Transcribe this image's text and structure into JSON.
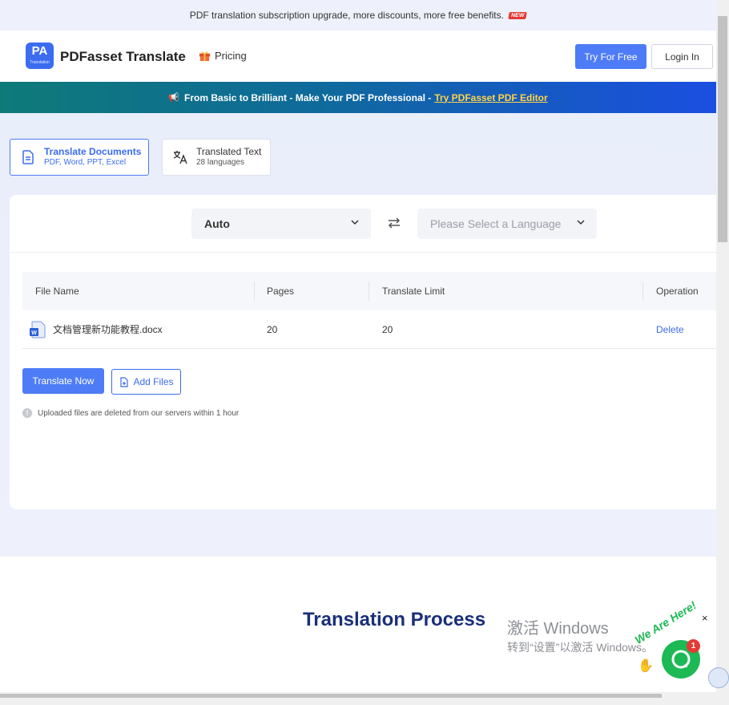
{
  "topbar": {
    "text": "PDF translation subscription upgrade, more discounts, more free benefits.",
    "badge": "NEW"
  },
  "header": {
    "logo_text": "PA",
    "logo_sub": "Translation",
    "brand": "PDFasset Translate",
    "pricing": "Pricing",
    "try_label": "Try For Free",
    "login_label": "Login In"
  },
  "promo": {
    "text": "From Basic to Brilliant - Make Your PDF Professional -",
    "link": "Try PDFasset PDF Editor"
  },
  "tabs": [
    {
      "title": "Translate Documents",
      "subtitle": "PDF, Word, PPT, Excel"
    },
    {
      "title": "Translated Text",
      "subtitle": "28 languages"
    }
  ],
  "language": {
    "source": "Auto",
    "target_placeholder": "Please Select a Language"
  },
  "table": {
    "headers": [
      "File Name",
      "Pages",
      "Translate Limit",
      "Operation"
    ],
    "rows": [
      {
        "file": "文档管理新功能教程.docx",
        "pages": "20",
        "limit": "20",
        "action": "Delete"
      }
    ]
  },
  "actions": {
    "translate": "Translate Now",
    "add": "Add Files"
  },
  "note": "Uploaded files are deleted from our servers within 1 hour",
  "section": {
    "title": "Translation Process"
  },
  "overlay": {
    "activate_title": "激活 Windows",
    "activate_sub": "转到“设置”以激活 Windows。"
  },
  "chat": {
    "badge": "1",
    "tagline": "We Are Here!",
    "close": "×"
  },
  "colors": {
    "accent": "#4e7cf6",
    "brand_dark": "#1a2f78",
    "chat_green": "#1db954"
  }
}
